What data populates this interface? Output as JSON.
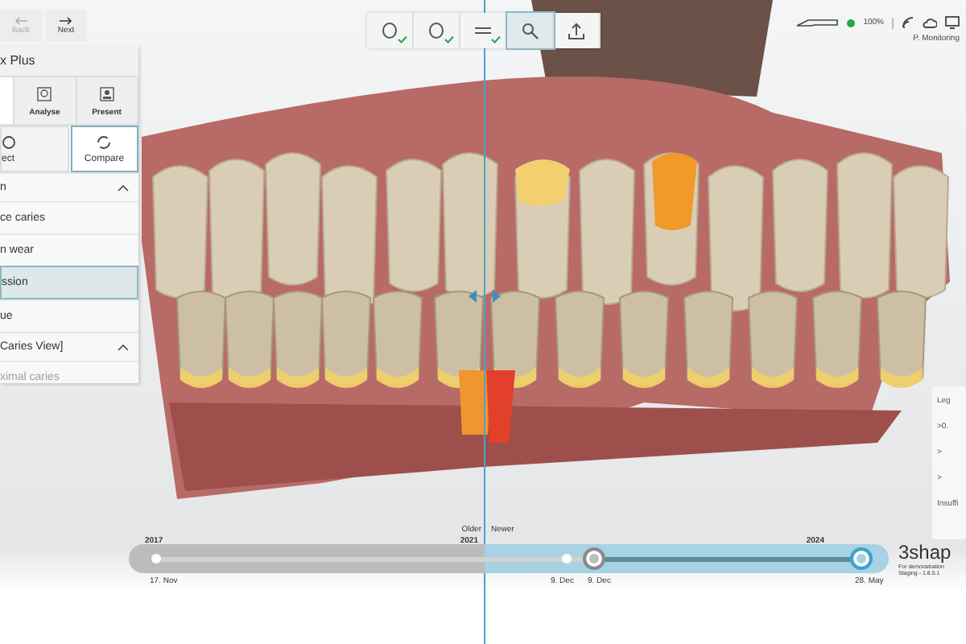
{
  "nav": [
    {
      "label": "Back",
      "disabled": true
    },
    {
      "label": "Next",
      "disabled": false
    }
  ],
  "sidebar": {
    "title": "x Plus",
    "tabs": [
      {
        "label": "Analyse",
        "selected": false
      },
      {
        "label": "Present",
        "selected": false
      }
    ],
    "modes": [
      {
        "label": "ect",
        "selected": false
      },
      {
        "label": "Compare",
        "selected": true
      }
    ],
    "sections": [
      {
        "title": "n",
        "expanded": true,
        "items": [
          {
            "label": "ce caries",
            "selected": false,
            "disabled": false
          },
          {
            "label": "n wear",
            "selected": false,
            "disabled": false
          },
          {
            "label": "ssion",
            "selected": true,
            "disabled": false
          },
          {
            "label": "ue",
            "selected": false,
            "disabled": false
          }
        ]
      },
      {
        "title": "Caries View]",
        "expanded": true,
        "items": [
          {
            "label": "ximal caries",
            "selected": false,
            "disabled": true
          }
        ]
      }
    ]
  },
  "toolbar": [
    {
      "kind": "circle",
      "done": true,
      "selected": false
    },
    {
      "kind": "circle",
      "done": true,
      "selected": false
    },
    {
      "kind": "lines",
      "done": true,
      "selected": false
    },
    {
      "kind": "search",
      "done": false,
      "selected": true
    },
    {
      "kind": "upload",
      "done": false,
      "selected": false
    }
  ],
  "status": {
    "battery": "100%",
    "connected": true,
    "user": "P. Monitoring"
  },
  "legend": {
    "title": "Leg",
    "rows": [
      ">0.",
      ">",
      ">"
    ],
    "footer": "Insuffi"
  },
  "timeline": {
    "older_label": "Older",
    "newer_label": "Newer",
    "years": [
      "2017",
      "2021",
      "2024"
    ],
    "points": [
      {
        "label": "17. Nov",
        "selected": false
      },
      {
        "label": "9. Dec",
        "selected": false
      },
      {
        "label": "9. Dec",
        "selected": true
      },
      {
        "label": "28. May",
        "selected": true
      }
    ]
  },
  "brand": {
    "logo": "3shap",
    "note": "For demonstration",
    "version": "Staging - 1.8.5.1"
  }
}
